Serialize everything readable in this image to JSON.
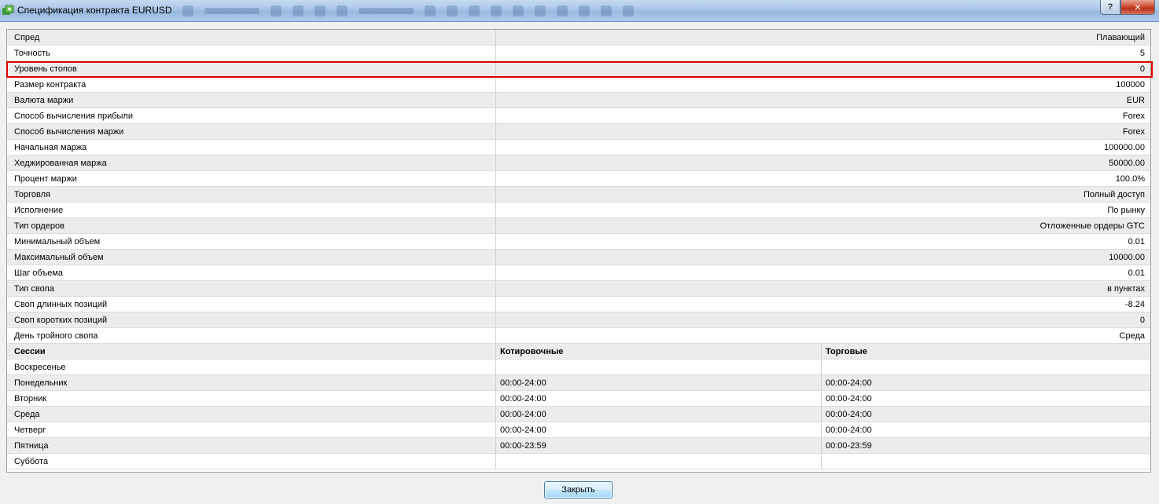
{
  "window": {
    "title": "Спецификация контракта EURUSD",
    "help_label": "?",
    "close_label": "✕"
  },
  "spec_rows": [
    {
      "label": "Спред",
      "value": "Плавающий"
    },
    {
      "label": "Точность",
      "value": "5"
    },
    {
      "label": "Уровень стопов",
      "value": "0"
    },
    {
      "label": "Размер контракта",
      "value": "100000"
    },
    {
      "label": "Валюта маржи",
      "value": "EUR"
    },
    {
      "label": "Способ вычисления прибыли",
      "value": "Forex"
    },
    {
      "label": "Способ вычисления маржи",
      "value": "Forex"
    },
    {
      "label": "Начальная маржа",
      "value": "100000.00"
    },
    {
      "label": "Хеджированная маржа",
      "value": "50000.00"
    },
    {
      "label": "Процент маржи",
      "value": "100.0%"
    },
    {
      "label": "Торговля",
      "value": "Полный доступ"
    },
    {
      "label": "Исполнение",
      "value": "По рынку"
    },
    {
      "label": "Тип ордеров",
      "value": "Отложенные ордеры GTC"
    },
    {
      "label": "Минимальный объем",
      "value": "0.01"
    },
    {
      "label": "Максимальный объем",
      "value": "10000.00"
    },
    {
      "label": "Шаг объема",
      "value": "0.01"
    },
    {
      "label": "Тип свопа",
      "value": "в пунктах"
    },
    {
      "label": "Своп длинных позиций",
      "value": "-8.24"
    },
    {
      "label": "Своп коротких позиций",
      "value": "0"
    },
    {
      "label": "День тройного свопа",
      "value": "Среда"
    }
  ],
  "sessions": {
    "headers": {
      "day": "Сессии",
      "quotes": "Котировочные",
      "trades": "Торговые"
    },
    "rows": [
      {
        "day": "Воскресенье",
        "quotes": "",
        "trades": ""
      },
      {
        "day": "Понедельник",
        "quotes": "00:00-24:00",
        "trades": "00:00-24:00"
      },
      {
        "day": "Вторник",
        "quotes": "00:00-24:00",
        "trades": "00:00-24:00"
      },
      {
        "day": "Среда",
        "quotes": "00:00-24:00",
        "trades": "00:00-24:00"
      },
      {
        "day": "Четверг",
        "quotes": "00:00-24:00",
        "trades": "00:00-24:00"
      },
      {
        "day": "Пятница",
        "quotes": "00:00-23:59",
        "trades": "00:00-23:59"
      },
      {
        "day": "Суббота",
        "quotes": "",
        "trades": ""
      }
    ]
  },
  "footer": {
    "close_button_label": "Закрыть"
  },
  "colors": {
    "highlight": "#e00000",
    "row_alt": "#ececec"
  }
}
